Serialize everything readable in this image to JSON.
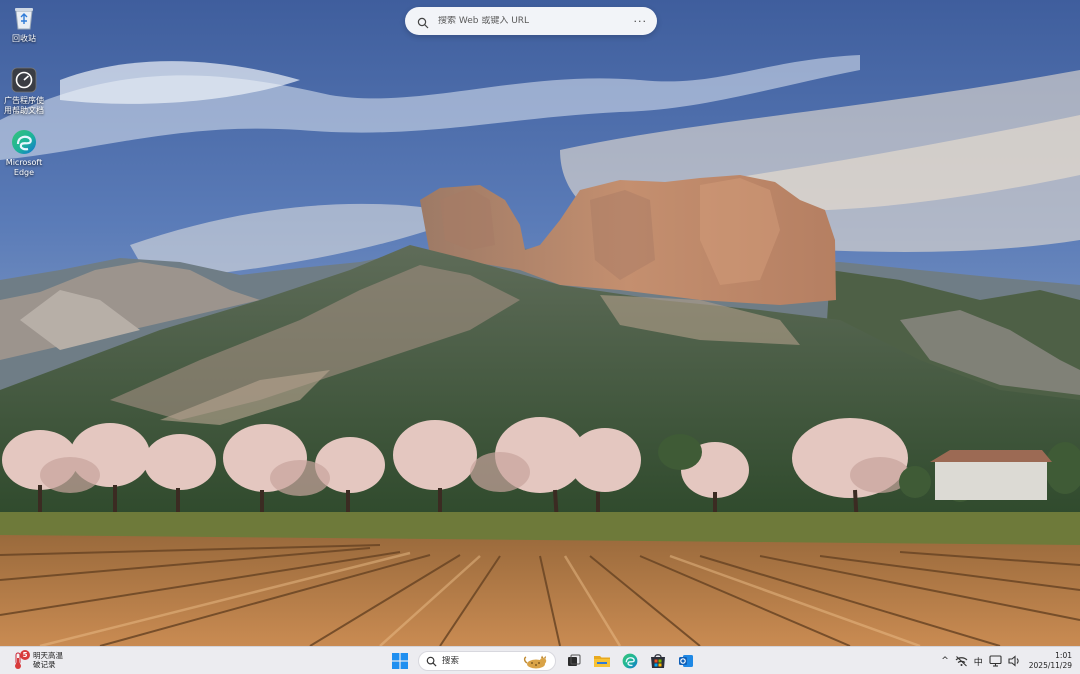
{
  "desktop": {
    "icons": [
      {
        "label": "回收站",
        "icon": "recycle-bin-icon"
      },
      {
        "label": "广告程序使用帮助文档",
        "icon": "speedometer-icon"
      },
      {
        "label": "Microsoft Edge",
        "icon": "edge-icon"
      }
    ]
  },
  "web_search": {
    "placeholder": "搜索 Web 或键入 URL",
    "more_label": "···"
  },
  "taskbar": {
    "weather": {
      "badge": "5",
      "line1": "明天高温",
      "line2": "破记录"
    },
    "search_placeholder": "搜索",
    "pinned": [
      "windows-start-icon",
      "search-icon",
      "task-view-icon",
      "file-explorer-icon",
      "edge-icon",
      "microsoft-store-icon",
      "outlook-icon"
    ],
    "tray": {
      "chevron": "^",
      "ime": "中",
      "time": "1:01",
      "date": "2025/11/29"
    }
  },
  "colors": {
    "taskbar_bg": "#ececf0",
    "win_blue": "#1f8ff0",
    "edge_teal": "#1db39a",
    "edge_blue": "#0f6fd6",
    "explorer_yellow": "#f7c234",
    "alert_red": "#d83b3b"
  }
}
